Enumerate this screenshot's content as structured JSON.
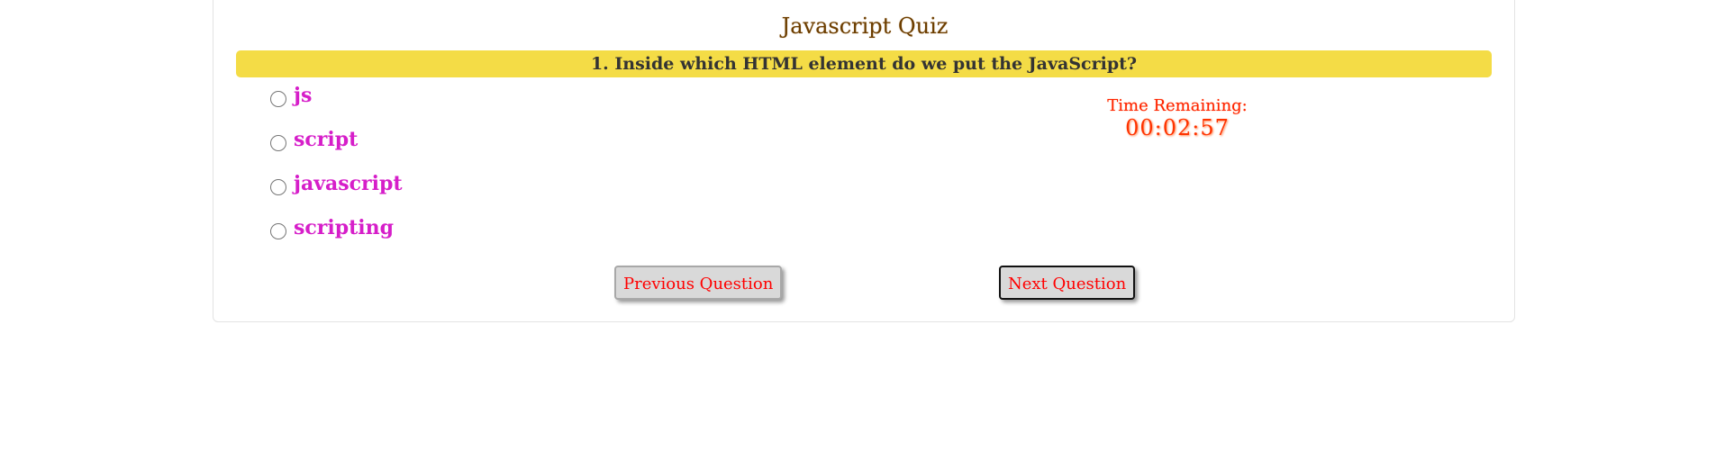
{
  "quiz": {
    "title": "Javascript Quiz",
    "question": "1. Inside which HTML element do we put the JavaScript?",
    "options": [
      {
        "label": "js",
        "selected": false
      },
      {
        "label": "script",
        "selected": false
      },
      {
        "label": "javascript",
        "selected": false
      },
      {
        "label": "scripting",
        "selected": false
      }
    ]
  },
  "timer": {
    "label": "Time Remaining:",
    "value": "00:02:57"
  },
  "navigation": {
    "previous_label": "Previous Question",
    "next_label": "Next Question"
  },
  "colors": {
    "question_bar": "#f4dc46",
    "option_text": "#d61ec9",
    "timer_text": "#ff2200",
    "button_text": "#ff0000"
  }
}
